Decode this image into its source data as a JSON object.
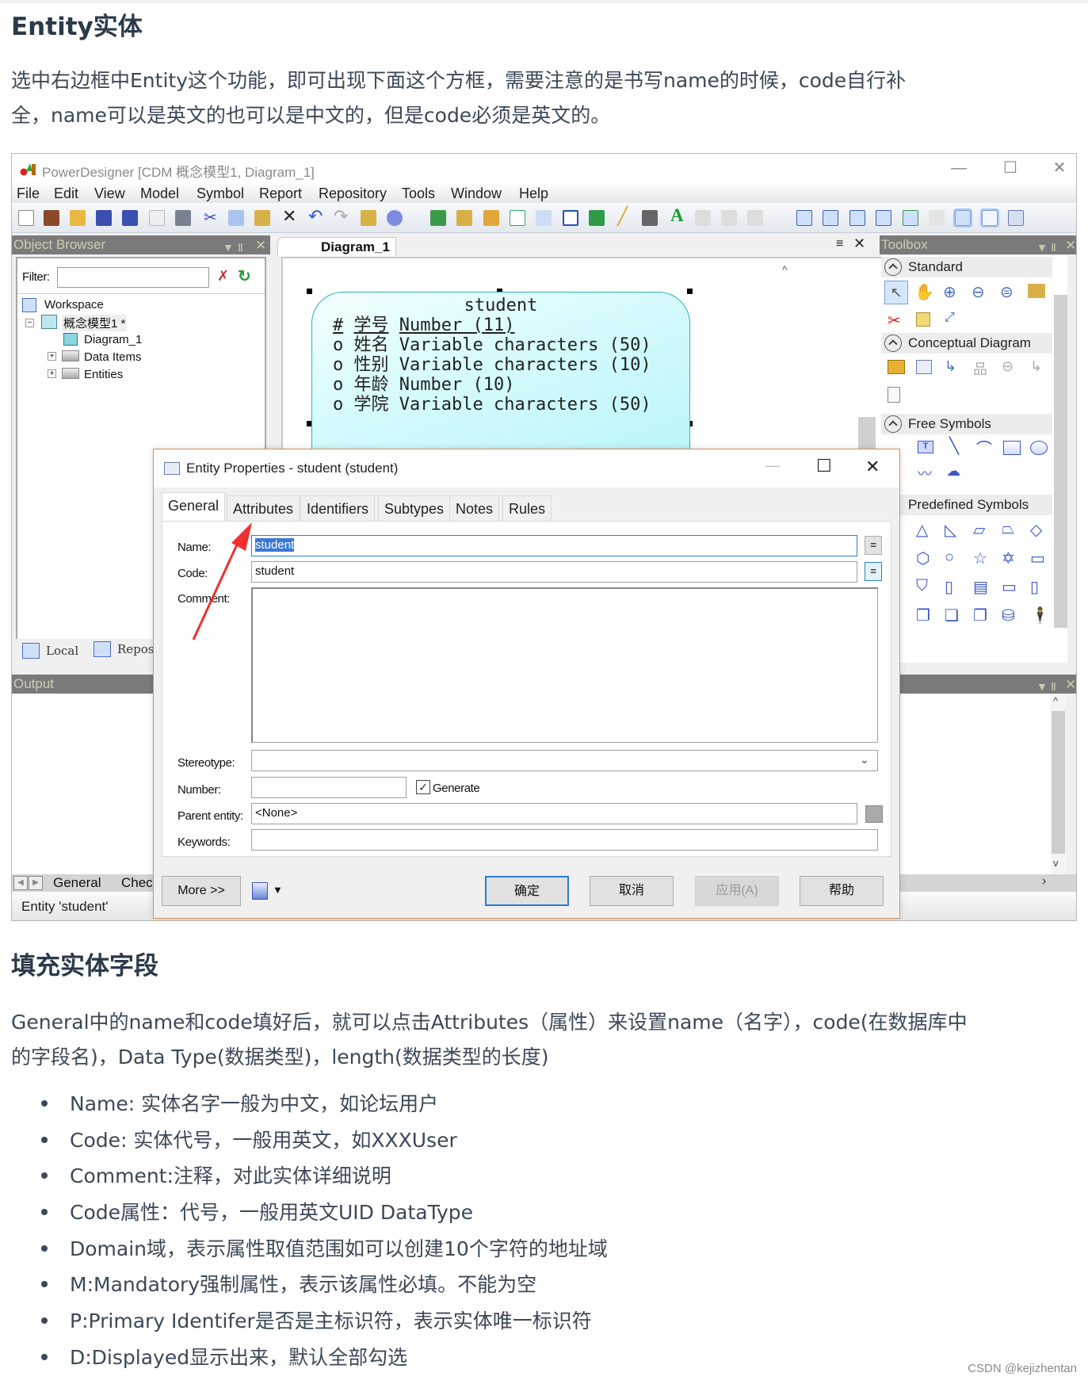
{
  "article": {
    "heading1": "Entity实体",
    "para1_line1": "选中右边框中Entity这个功能，即可出现下面这个方框，需要注意的是书写name的时候，code自行补",
    "para1_line2": "全，name可以是英文的也可以是中文的，但是code必须是英文的。",
    "heading2": "填充实体字段",
    "para2_line1": "General中的name和code填好后，就可以点击Attributes（属性）来设置name（名字），code(在数据库中",
    "para2_line2": "的字段名)，Data Type(数据类型)，length(数据类型的长度)",
    "bullets": [
      "Name: 实体名字一般为中文，如论坛用户",
      "Code: 实体代号，一般用英文，如XXXUser",
      "Comment:注释，对此实体详细说明",
      "Code属性：代号，一般用英文UID DataType",
      "Domain域，表示属性取值范围如可以创建10个字符的地址域",
      "M:Mandatory强制属性，表示该属性必填。不能为空",
      "P:Primary Identifer是否是主标识符，表示实体唯一标识符",
      "D:Displayed显示出来，默认全部勾选"
    ],
    "watermark": "CSDN @kejizhentan"
  },
  "app": {
    "title": "PowerDesigner [CDM 概念模型1, Diagram_1]",
    "window_controls": {
      "minimize": "—",
      "maximize": "☐",
      "close": "✕"
    },
    "menu": [
      "File",
      "Edit",
      "View",
      "Model",
      "Symbol",
      "Report",
      "Repository",
      "Tools",
      "Window",
      "Help"
    ],
    "object_browser": {
      "title": "Object Browser",
      "filter_label": "Filter:",
      "filter_value": "",
      "tree": {
        "workspace": "Workspace",
        "model": "概念模型1 *",
        "diagram": "Diagram_1",
        "data_items": "Data Items",
        "entities": "Entities"
      },
      "tabs": [
        "Local",
        "Reposi"
      ]
    },
    "diagram": {
      "tab": "Diagram_1",
      "entity": {
        "name": "student",
        "rows": [
          {
            "marker": "#",
            "name": "学号",
            "type": "Number (11)",
            "primary": true
          },
          {
            "marker": "o",
            "name": "姓名",
            "type": "Variable characters (50)",
            "primary": false
          },
          {
            "marker": "o",
            "name": "性别",
            "type": "Variable characters (10)",
            "primary": false
          },
          {
            "marker": "o",
            "name": "年龄",
            "type": "Number (10)",
            "primary": false
          },
          {
            "marker": "o",
            "name": "学院",
            "type": "Variable characters (50)",
            "primary": false
          }
        ]
      }
    },
    "toolbox": {
      "title": "Toolbox",
      "sections": [
        "Standard",
        "Conceptual Diagram",
        "Free Symbols",
        "Predefined Symbols"
      ]
    },
    "output": {
      "title": "Output",
      "tabs": [
        "General",
        "Chec"
      ]
    },
    "status": "Entity 'student'"
  },
  "dialog": {
    "title": "Entity Properties - student (student)",
    "tabs": [
      "General",
      "Attributes",
      "Identifiers",
      "Subtypes",
      "Notes",
      "Rules"
    ],
    "active_tab": "General",
    "labels": {
      "name": "Name:",
      "code": "Code:",
      "comment": "Comment:",
      "stereotype": "Stereotype:",
      "number": "Number:",
      "parent": "Parent entity:",
      "keywords": "Keywords:"
    },
    "values": {
      "name": "student",
      "code": "student",
      "comment": "",
      "stereotype": "",
      "number": "",
      "parent": "<None>",
      "keywords": ""
    },
    "generate_label": "Generate",
    "generate_checked": true,
    "eq_label": "=",
    "buttons": {
      "more": "More >>",
      "ok": "确定",
      "cancel": "取消",
      "apply": "应用(A)",
      "help": "帮助"
    }
  },
  "colors": {
    "heading": "#2b3a4a",
    "body_text": "#3c4858",
    "entity_border": "#2fb0b0",
    "entity_fill": "#c6f7fa",
    "focus_blue": "#2c7fd6",
    "annotation_arrow": "#f03030",
    "dialog_border": "#d8905a"
  }
}
